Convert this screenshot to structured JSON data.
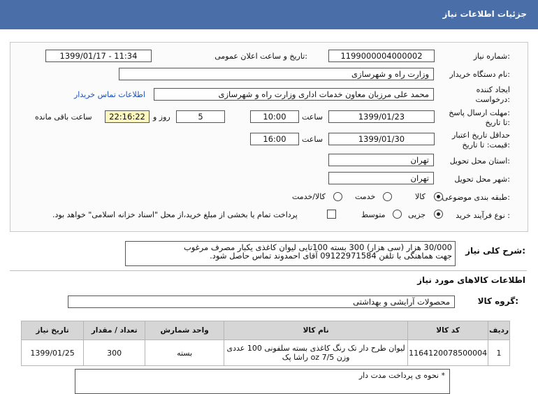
{
  "header": {
    "title": "جزئیات اطلاعات نیاز"
  },
  "form": {
    "need_number_label": "شماره نیاز:",
    "need_number": "1199000004000002",
    "announce_label": "تاریخ و ساعت اعلان عمومی:",
    "announce_value": "1399/01/17 - 11:34",
    "buyer_org_label": "نام دستگاه خریدار:",
    "buyer_org": "وزارت راه و شهرسازی",
    "creator_label_1": "ایجاد کننده",
    "creator_label_2": "درخواست:",
    "creator": "محمد علی  مرزبان معاون خدمات اداری وزارت راه و شهرسازی",
    "contact_link": "اطلاعات تماس خریدار",
    "send_deadline_label_1": "مهلت ارسال پاسخ:",
    "send_deadline_label_2": "تا تاریخ:",
    "send_date": "1399/01/23",
    "time_label": "ساعت",
    "send_time": "10:00",
    "days": "5",
    "days_label": "روز و",
    "remaining": "22:16:22",
    "remaining_label": "ساعت باقی مانده",
    "validity_label_1": "حداقل تاریخ اعتبار",
    "validity_label_2": "قیمت: تا تاریخ:",
    "validity_date": "1399/01/30",
    "validity_time_label": "ساعت",
    "validity_time": "16:00",
    "province_label": "استان محل تحویل:",
    "province": "تهران",
    "city_label": "شهر محل تحویل:",
    "city": "تهران",
    "category_label": "طبقه بندی موضوعی:",
    "category_options": [
      "کالا",
      "خدمت",
      "کالا/خدمت"
    ],
    "category_selected": "کالا",
    "process_label": "نوع فرآیند خرید :",
    "process_options": [
      "جزیی",
      "متوسط"
    ],
    "process_selected": "جزیی",
    "treasury_text": "پرداخت تمام یا بخشی از مبلغ خرید،از محل \"اسناد خزانه اسلامی\" خواهد بود."
  },
  "description": {
    "label": "شرح کلی نیاز:",
    "line1": "30/000 هزار (سی هزار) 300 بسته 100تایی لیوان کاغذی یکبار مصرف مرغوب",
    "line2": "جهت هماهنگی با تلفن 09122971584 آقای احمدوند تماس حاصل شود."
  },
  "goods": {
    "section_title": "اطلاعات کالاهای مورد نیاز",
    "group_label": "گروه کالا:",
    "group_value": "محصولات آرایشی و بهداشتی",
    "columns": [
      "ردیف",
      "کد کالا",
      "نام کالا",
      "واحد شمارش",
      "تعداد / مقدار",
      "تاریخ نیاز"
    ],
    "rows": [
      {
        "index": "1",
        "code": "1164120078500004",
        "name_line1": "لیوان طرح دار تک رنگ کاغذی بسته سلفونی 100 عددی",
        "name_line2": "وزن oz 7/5 راشا پک",
        "unit": "بسته",
        "qty": "300",
        "date": "1399/01/25"
      }
    ]
  },
  "note": {
    "text": "* نحوه ی پرداخت مدت دار"
  },
  "colors": {
    "header_bg": "#4a6fa8",
    "link": "#1a4fb5",
    "remaining_bg": "#fdf6bf"
  }
}
